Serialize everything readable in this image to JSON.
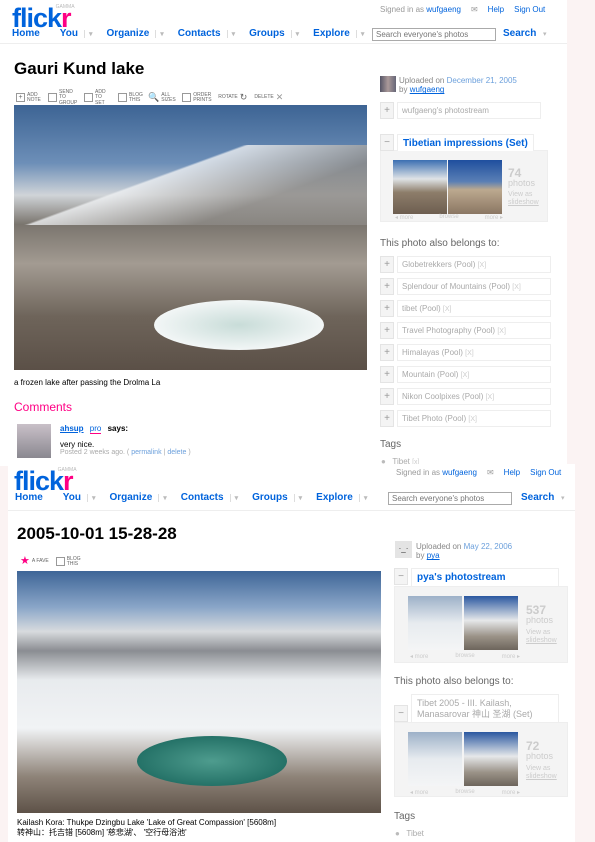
{
  "pages": [
    {
      "header": {
        "logo": "flickr",
        "logo_badge": "GAMMA",
        "signed_in_prefix": "Signed in as",
        "user": "wufgaeng",
        "help": "Help",
        "sign_out": "Sign Out",
        "nav": [
          "Home",
          "You",
          "Organize",
          "Contacts",
          "Groups",
          "Explore"
        ],
        "search_placeholder": "Search everyone's photos",
        "search_button": "Search"
      },
      "title": "Gauri Kund lake",
      "toolbar": [
        {
          "label": "ADD NOTE"
        },
        {
          "label": "SEND TO GROUP"
        },
        {
          "label": "ADD TO SET"
        },
        {
          "label": "BLOG THIS"
        },
        {
          "label": "ALL SIZES"
        },
        {
          "label": "ORDER PRINTS"
        },
        {
          "label": "ROTATE"
        },
        {
          "label": "DELETE"
        }
      ],
      "caption": "a frozen lake after passing the Drolma La",
      "comments_heading": "Comments",
      "comment": {
        "author": "ahsup",
        "badge": "pro",
        "says": "says:",
        "text": "very nice.",
        "posted": "Posted 2 weeks ago. (",
        "permalink": "permalink",
        "sep": "|",
        "delete": "delete",
        "close": ")"
      },
      "sidebar": {
        "uploaded_prefix": "Uploaded on",
        "date": "December 21, 2005",
        "by": "by",
        "owner": "wufgaeng",
        "photostream": "wufgaeng's photostream",
        "set_title": "Tibetian impressions (Set)",
        "set_count": "74",
        "photos_label": "photos",
        "view_as": "View as",
        "slideshow": "slideshow",
        "more_prev": "◂ more",
        "browse": "browse",
        "more_next": "more ▸",
        "also_belongs": "This photo also belongs to:",
        "pools": [
          "Globetrekkers (Pool)",
          "Splendour of Mountains (Pool)",
          "tibet (Pool)",
          "Travel Photography (Pool)",
          "Himalayas (Pool)",
          "Mountain (Pool)",
          "Nikon Coolpixes (Pool)",
          "Tibet Photo (Pool)"
        ],
        "remove": "[X]",
        "tags_heading": "Tags",
        "tags": [
          "Tibet"
        ],
        "tag_remove": "[x]"
      }
    },
    {
      "header": {
        "logo": "flickr",
        "logo_badge": "GAMMA",
        "signed_in_prefix": "Signed in as",
        "user": "wufgaeng",
        "help": "Help",
        "sign_out": "Sign Out",
        "nav": [
          "Home",
          "You",
          "Organize",
          "Contacts",
          "Groups",
          "Explore"
        ],
        "search_placeholder": "Search everyone's photos",
        "search_button": "Search"
      },
      "title": "2005-10-01 15-28-28",
      "toolbar": [
        {
          "label": "A FAVE"
        },
        {
          "label": "BLOG THIS"
        }
      ],
      "caption": "Kailash Kora: Thukpe Dzingbu Lake 'Lake of Great Compassion' [5608m]",
      "caption2": "转神山：托吉错 [5608m] '慈悲湖'、 '空行母浴池'",
      "sidebar": {
        "uploaded_prefix": "Uploaded on",
        "date": "May 22, 2006",
        "by": "by",
        "owner": "pya",
        "photostream": "pya's photostream",
        "stream_count": "537",
        "photos_label": "photos",
        "view_as": "View as",
        "slideshow": "slideshow",
        "more_prev": "◂ more",
        "browse": "browse",
        "more_next": "more ▸",
        "also_belongs": "This photo also belongs to:",
        "set_title": "Tibet 2005 - III. Kailash, Manasarovar 神山 圣湖 (Set)",
        "set_count": "72",
        "tags_heading": "Tags",
        "tags": [
          "Tibet"
        ]
      }
    }
  ],
  "colors": {
    "flickr_blue": "#0063dc",
    "flickr_pink": "#ff0084"
  }
}
